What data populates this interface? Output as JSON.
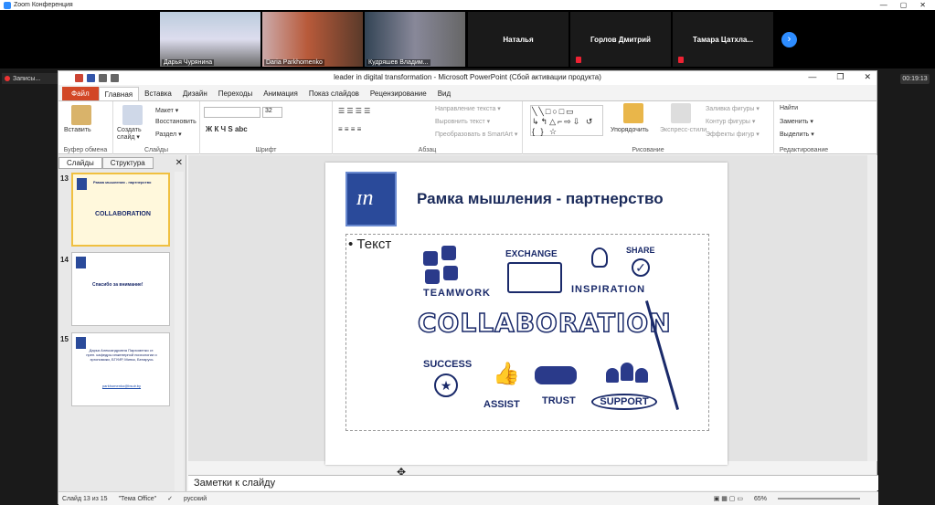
{
  "zoom": {
    "title": "Zoom Конференция",
    "min": "—",
    "max": "▢",
    "close": "✕"
  },
  "participants": [
    {
      "name": "Дарья Чурянина",
      "type": "video"
    },
    {
      "name": "Daria Parkhomenko",
      "type": "video"
    },
    {
      "name": "Кудряшев Владим...",
      "type": "video"
    },
    {
      "name": "Наталья",
      "type": "name"
    },
    {
      "name": "Горлов Дмитрий",
      "type": "name"
    },
    {
      "name": "Тамара  Цатхла...",
      "type": "name"
    }
  ],
  "recording": "Записы...",
  "timer": "00:19:13",
  "ppt": {
    "title": "leader in digital transformation  -  Microsoft PowerPoint (Сбой активации продукта)",
    "tabs": [
      "Файл",
      "Главная",
      "Вставка",
      "Дизайн",
      "Переходы",
      "Анимация",
      "Показ слайдов",
      "Рецензирование",
      "Вид"
    ],
    "groups": {
      "clipboard": "Буфер обмена",
      "slides": "Слайды",
      "font": "Шрифт",
      "paragraph": "Абзац",
      "drawing": "Рисование",
      "editing": "Редактирование"
    },
    "buttons": {
      "paste": "Вставить",
      "create_slide": "Создать слайд ▾",
      "layout": "Макет ▾",
      "reset": "Восстановить",
      "section": "Раздел ▾",
      "font_size": "32",
      "text_dir": "Направление текста ▾",
      "align_text": "Выровнить текст ▾",
      "smartart": "Преобразовать в SmartArt ▾",
      "arrange": "Упорядочить",
      "quick_styles": "Экспресс-стили",
      "fill": "Заливка фигуры ▾",
      "outline": "Контур фигуры ▾",
      "effects": "Эффекты фигур ▾",
      "find": "Найти",
      "replace": "Заменить ▾",
      "select": "Выделить ▾"
    },
    "pane_tabs": [
      "Слайды",
      "Структура"
    ],
    "thumbs": [
      {
        "num": "13",
        "title": "Рамка мышления - партнерство",
        "sub": "COLLABORATION"
      },
      {
        "num": "14",
        "title": "Спасибо за внимание!",
        "sub": ""
      },
      {
        "num": "15",
        "title": "Дарья Александровна Пархоменко ст. преп. кафедры инженерной психологии и эргономики, БГУИР, Минск, Беларусь",
        "sub": "parkhomenko@bsuir.by"
      }
    ],
    "slide": {
      "title": "Рамка мышления - партнерство",
      "bullet": "Текст",
      "words": {
        "teamwork": "TEAMWORK",
        "exchange": "EXCHANGE",
        "inspiration": "INSPIRATION",
        "share": "SHARE",
        "collab": "COLLABORATION",
        "success": "SUCCESS",
        "assist": "ASSIST",
        "trust": "TRUST",
        "support": "SUPPORT"
      }
    },
    "notes": "Заметки к слайду",
    "status": {
      "slide": "Слайд 13 из 15",
      "theme": "\"Тема Office\"",
      "lang": "русский",
      "zoom": "65%"
    }
  }
}
